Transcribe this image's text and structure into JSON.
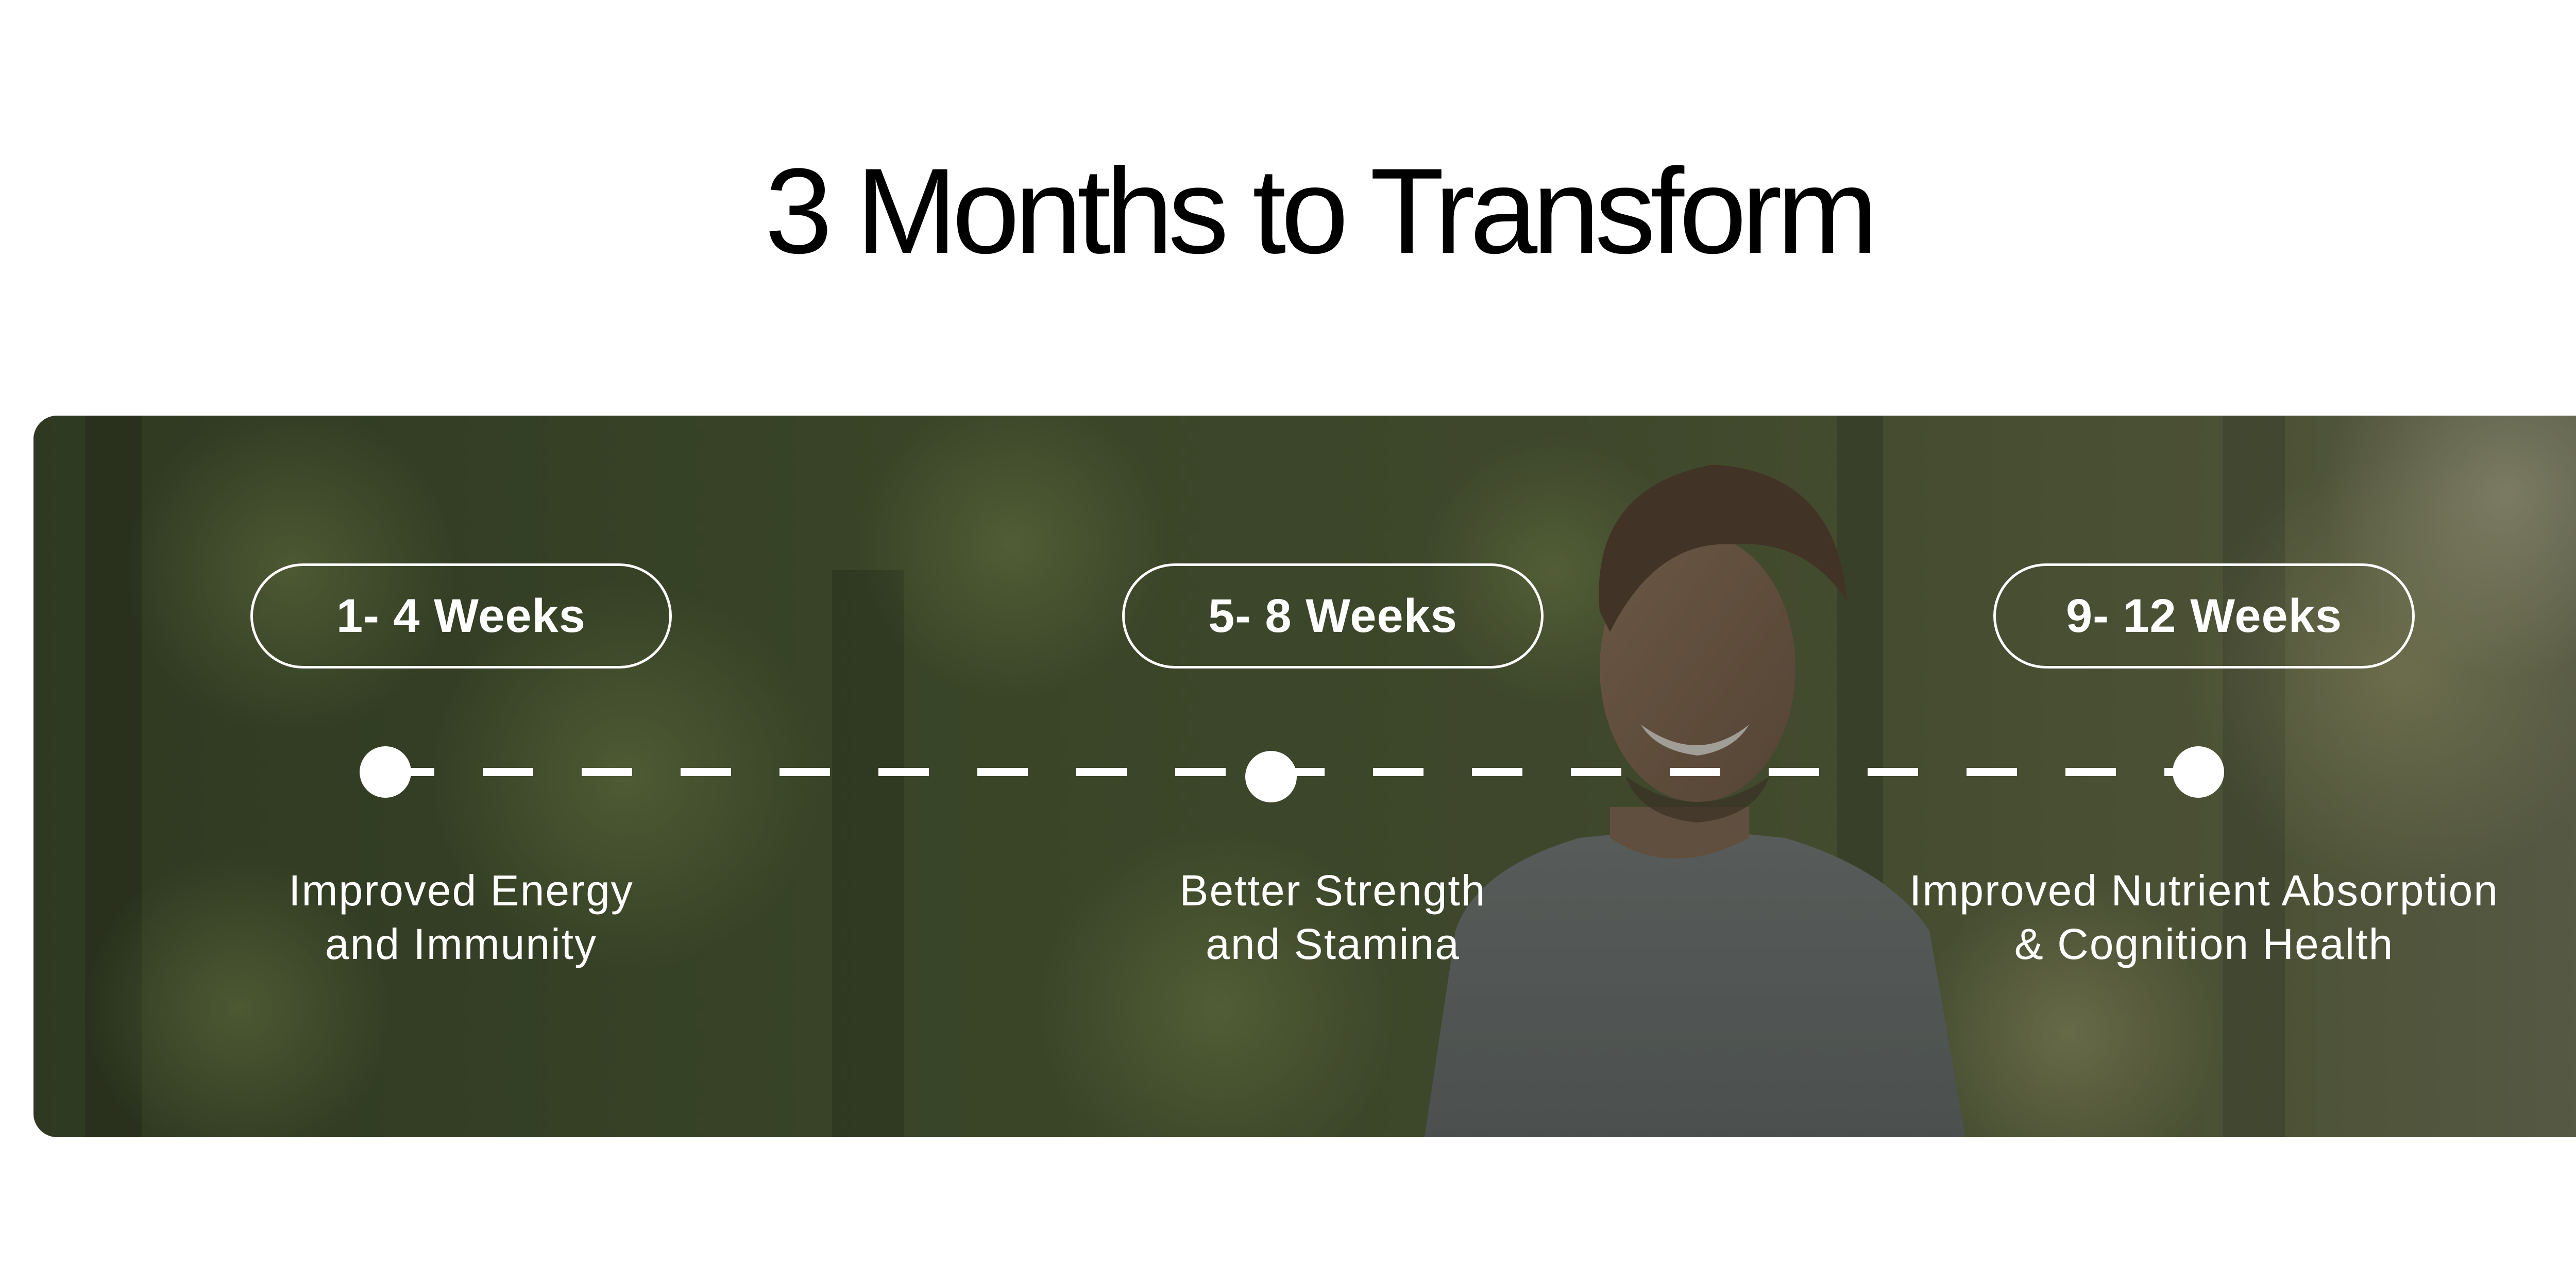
{
  "title": "3 Months to Transform",
  "hero": {
    "image": "smiling-man-running-in-forest",
    "overlay_color": "#2f3a25"
  },
  "milestones": [
    {
      "period": "1- 4 Weeks",
      "benefit_line1": "Improved Energy",
      "benefit_line2": "and Immunity"
    },
    {
      "period": "5- 8 Weeks",
      "benefit_line1": "Better Strength",
      "benefit_line2": "and Stamina"
    },
    {
      "period": "9- 12 Weeks",
      "benefit_line1": "Improved Nutrient Absorption",
      "benefit_line2": "& Cognition Health"
    }
  ],
  "colors": {
    "title": "#000000",
    "timeline": "#ffffff",
    "background": "#ffffff"
  }
}
